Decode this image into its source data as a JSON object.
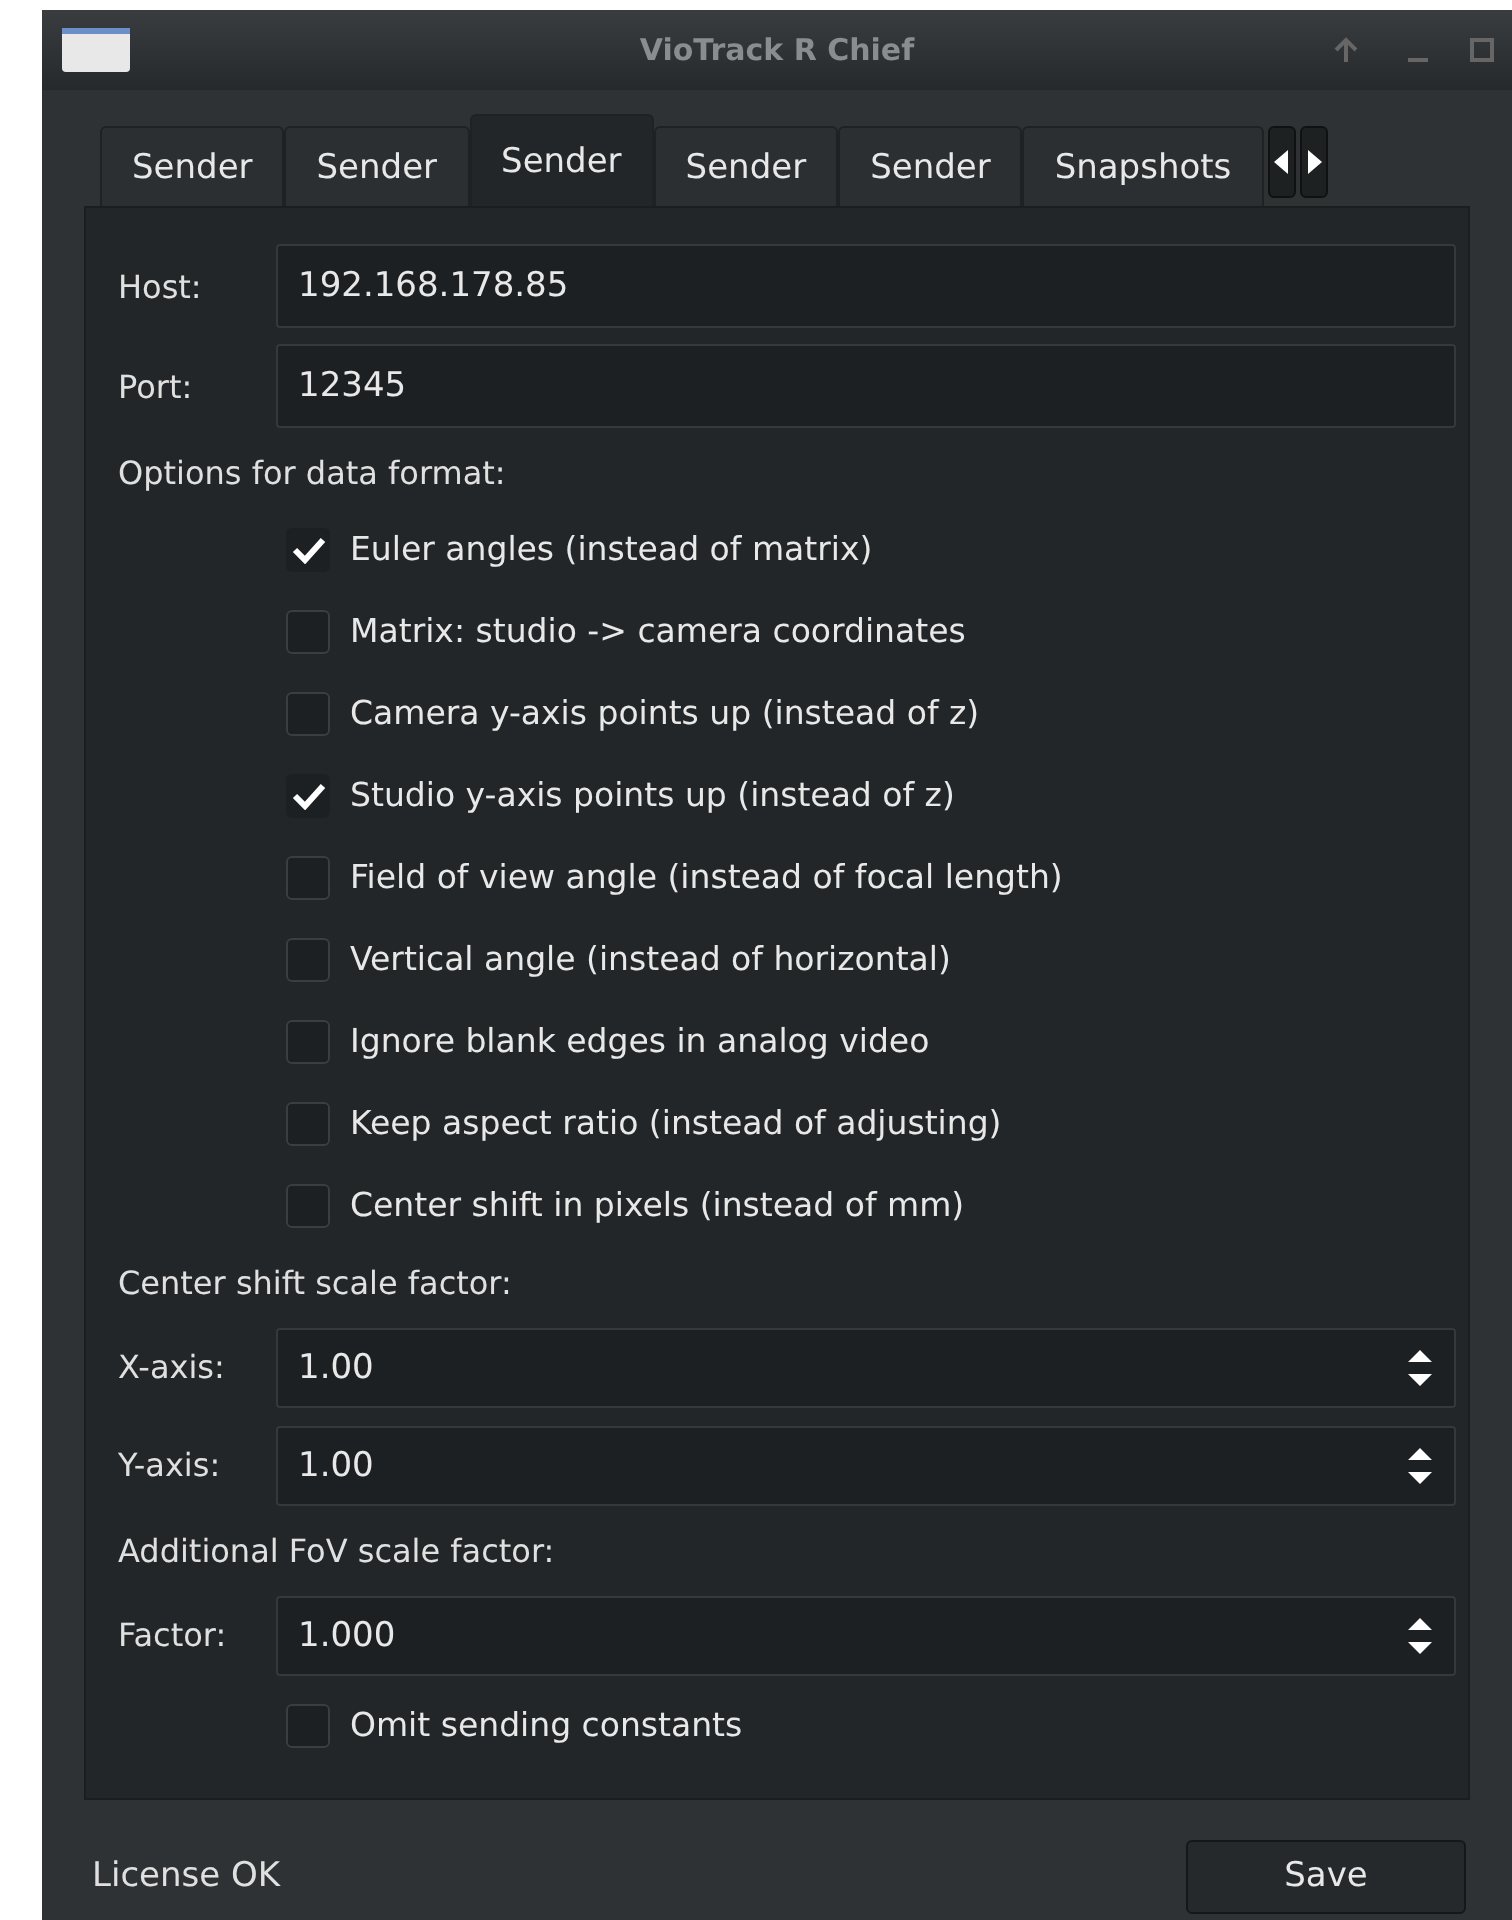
{
  "window": {
    "title": "VioTrack R Chief"
  },
  "tabs": [
    {
      "label": "Sender",
      "selected": false
    },
    {
      "label": "Sender",
      "selected": false
    },
    {
      "label": "Sender",
      "selected": true
    },
    {
      "label": "Sender",
      "selected": false
    },
    {
      "label": "Sender",
      "selected": false
    },
    {
      "label": "Snapshots",
      "selected": false
    }
  ],
  "fields": [
    {
      "label": "Host:",
      "value": "192.168.178.85"
    },
    {
      "label": "Port:",
      "value": "12345"
    }
  ],
  "options_heading": "Options for data format:",
  "options": [
    {
      "label": "Euler angles (instead of matrix)",
      "checked": true
    },
    {
      "label": "Matrix: studio -> camera coordinates",
      "checked": false
    },
    {
      "label": "Camera y-axis points up (instead of z)",
      "checked": false
    },
    {
      "label": "Studio y-axis points up (instead of z)",
      "checked": true
    },
    {
      "label": "Field of view angle (instead of focal length)",
      "checked": false
    },
    {
      "label": "Vertical angle (instead of horizontal)",
      "checked": false
    },
    {
      "label": "Ignore blank edges in analog video",
      "checked": false
    },
    {
      "label": "Keep aspect ratio (instead of adjusting)",
      "checked": false
    },
    {
      "label": "Center shift in pixels (instead of mm)",
      "checked": false
    }
  ],
  "shift_heading": "Center shift scale factor:",
  "shift_spinners": [
    {
      "label": "X-axis:",
      "value": "1.00"
    },
    {
      "label": "Y-axis:",
      "value": "1.00"
    }
  ],
  "fov_heading": "Additional FoV scale factor:",
  "fov_spinners": [
    {
      "label": "Factor:",
      "value": "1.000"
    }
  ],
  "omit_option": {
    "label": "Omit sending constants",
    "checked": false
  },
  "status": "License OK",
  "save_button": "Save"
}
